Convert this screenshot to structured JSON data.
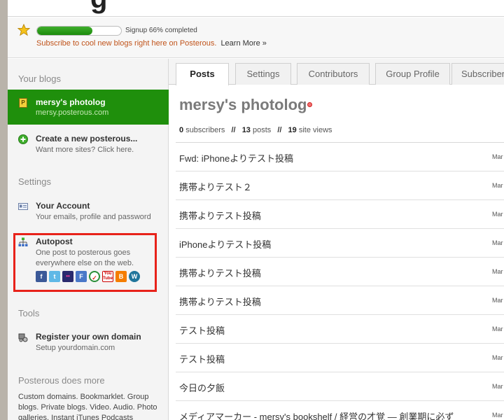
{
  "header": {
    "logo_fragment": "g",
    "signup_progress": 0.66,
    "signup_text": "Signup 66% completed",
    "subscribe_text": "Subscribe to cool new blogs right here on Posterous.",
    "learn_more": "Learn More »"
  },
  "sidebar": {
    "your_blogs_heading": "Your blogs",
    "selected_blog": {
      "name": "mersy's photolog",
      "url": "mersy.posterous.com",
      "icon": "P"
    },
    "create_title": "Create a new posterous...",
    "create_desc": "Want more sites? Click here.",
    "settings_heading": "Settings",
    "account_title": "Your Account",
    "account_desc": "Your emails, profile and password",
    "autopost_title": "Autopost",
    "autopost_desc": "One post to posterous goes everywhere else on the web.",
    "social_icons": [
      "f",
      "t",
      "••",
      "F",
      "✓",
      "You Tube",
      "B",
      "W"
    ],
    "tools_heading": "Tools",
    "domain_title": "Register your own domain",
    "domain_desc": "Setup yourdomain.com",
    "more_heading": "Posterous does more",
    "more_text": "Custom domains. Bookmarklet. Group blogs. Private blogs. Video. Audio. Photo galleries. Instant iTunes Podcasts"
  },
  "tabs": [
    "Posts",
    "Settings",
    "Contributors",
    "Group Profile",
    "Subscriber"
  ],
  "blog": {
    "title": "mersy's photolog",
    "subscribers_count": "0",
    "subscribers_label": "subscribers",
    "posts_count": "13",
    "posts_label": "posts",
    "views_count": "19",
    "views_label": "site views",
    "separator": "//"
  },
  "posts": [
    {
      "title": "Fwd: iPhoneよりテスト投稿",
      "date": "Mar"
    },
    {
      "title": "携帯よりテスト２",
      "date": "Mar"
    },
    {
      "title": "携帯よりテスト投稿",
      "date": "Mar"
    },
    {
      "title": "iPhoneよりテスト投稿",
      "date": "Mar"
    },
    {
      "title": "携帯よりテスト投稿",
      "date": "Mar"
    },
    {
      "title": "携帯よりテスト投稿",
      "date": "Mar"
    },
    {
      "title": "テスト投稿",
      "date": "Mar"
    },
    {
      "title": "テスト投稿",
      "date": "Mar"
    },
    {
      "title": "今日の夕飯",
      "date": "Mar"
    },
    {
      "title": "メディアマーカー - mersy's bookshelf / 経営の才覚 — 創業期に必ず",
      "date": "Mar"
    }
  ]
}
